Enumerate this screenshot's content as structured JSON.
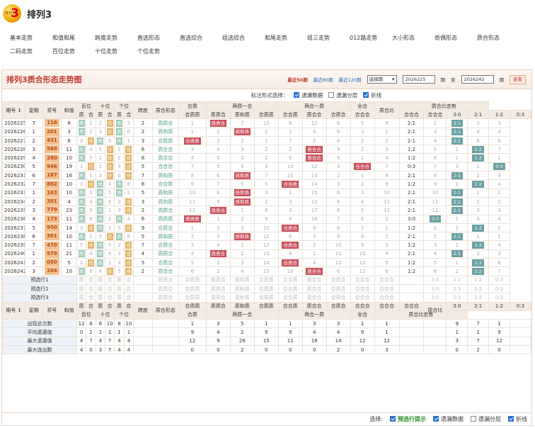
{
  "app": {
    "logo_num": "3",
    "logo_small": "排列",
    "title": "排列3"
  },
  "nav": {
    "row1": [
      "基本走势",
      "和值和尾",
      "跨度走势",
      "直选形态",
      "直选综合",
      "组选综合",
      "和尾走势",
      "组三走势",
      "012路走势",
      "大小形态",
      "奇偶形态",
      "质合形态"
    ],
    "row2": [
      "二码走势",
      "百位走势",
      "十位走势",
      "个位走势"
    ]
  },
  "panel": {
    "title": "排列3质合形态走势图",
    "range": [
      "最近50期",
      "最近80期",
      "最近120期"
    ],
    "select": "选择期",
    "from": "2026225",
    "to": "2026242",
    "qi": "期",
    "zhi": "至",
    "btn": "查看"
  },
  "options": {
    "label": "标注形式选择：",
    "o1": "遗漏数据",
    "o2": "遗漏分层",
    "o3": "折线"
  },
  "h": {
    "qihao": "期号",
    "xingqi": "星期",
    "kaijiang": "奖号",
    "hezhi": "和值",
    "bai": "百位",
    "shi": "十位",
    "ge": "个位",
    "kuadu": "跨度",
    "xingtai": "质合形态",
    "g1": "合质",
    "g2": "两质一合",
    "g3": "两合一质",
    "g4": "全合",
    "zhb": "质合比",
    "zhbzs": "质合比走势",
    "zhi": "质",
    "he": "合",
    "zhizhi": "合质质",
    "zhihezhi": "质质合",
    "zhiheh": "质和质",
    "hezhih": "合质质",
    "hehezhi": "合合质",
    "zhihehe": "质合合",
    "hezhihe": "合质合",
    "hehehe": "合合合",
    "hhh": "合合合",
    "r30": "3:0",
    "r21": "2:1",
    "r12": "1:2",
    "r03": "0:3"
  },
  "rows": [
    [
      "2026225",
      "7",
      "116",
      "8",
      "zhi",
      "he",
      "zhi",
      "2",
      0,
      1,
      7,
      15,
      8,
      12,
      6,
      5,
      "质质合",
      0,
      [
        "2:1",
        2,
        1,
        3
      ]
    ],
    [
      "2026226",
      "1",
      "201",
      "3",
      "zhi",
      "he",
      "zhi",
      "2",
      1,
      2,
      20,
      2,
      1,
      4,
      6,
      3,
      "质和质",
      0,
      [
        "2:1",
        3,
        0,
        4
      ]
    ],
    [
      "2026227",
      "2",
      "431",
      "8",
      "he",
      "zhi",
      "zhi",
      "3",
      2,
      3,
      2,
      1,
      0,
      5,
      4,
      2,
      "合质质",
      0,
      [
        "2:1",
        4,
        1,
        6
      ]
    ],
    [
      "2026228",
      "3",
      "560",
      "11",
      "zhi",
      "he",
      "he",
      "6",
      3,
      4,
      3,
      2,
      2,
      8,
      9,
      0,
      "质合合",
      0,
      [
        "1:2",
        5,
        1,
        0
      ]
    ],
    [
      "2026229",
      "4",
      "280",
      "10",
      "zhi",
      "he",
      "he",
      "8",
      4,
      5,
      3,
      2,
      6,
      6,
      9,
      1,
      "质合合",
      0,
      [
        "1:2",
        6,
        1,
        0
      ]
    ],
    [
      "2026230",
      "5",
      "946",
      "19",
      "he",
      "he",
      "he",
      "5",
      7,
      5,
      4,
      3,
      10,
      12,
      0,
      0,
      "合合合",
      0,
      [
        "0:3",
        7,
        3,
        1
      ]
    ],
    [
      "2026231",
      "6",
      "187",
      "16",
      "zhi",
      "he",
      "he",
      "7",
      8,
      6,
      6,
      7,
      11,
      13,
      2,
      1,
      "质和质",
      0,
      [
        "2:1",
        8,
        2,
        0
      ]
    ],
    [
      "2026232",
      "7",
      "802",
      "10",
      "he",
      "zhi",
      "zhi",
      "8",
      9,
      7,
      5,
      5,
      0,
      14,
      3,
      2,
      "合合质",
      0,
      [
        "1:2",
        9,
        1,
        0
      ]
    ],
    [
      "2026233",
      "1",
      "163",
      "10",
      "zhi",
      "zhi",
      "zhi",
      "5",
      10,
      8,
      6,
      3,
      1,
      15,
      6,
      3,
      "质和质",
      0,
      [
        "2:1",
        10,
        0,
        1
      ]
    ],
    [
      "2026234",
      "2",
      "301",
      "4",
      "zhi",
      "zhi",
      "he",
      "3",
      11,
      9,
      6,
      2,
      3,
      10,
      6,
      4,
      "质和质",
      0,
      [
        "2:1",
        11,
        1,
        2
      ]
    ],
    [
      "2026235",
      "3",
      "779",
      "23",
      "zhi",
      "zhi",
      "he",
      "2",
      12,
      0,
      1,
      8,
      3,
      17,
      6,
      5,
      "质质合",
      0,
      [
        "2:1",
        12,
        1,
        3
      ]
    ],
    [
      "2026236",
      "4",
      "173",
      "11",
      "zhi",
      "zhi",
      "zhi",
      "6",
      0,
      1,
      2,
      9,
      4,
      18,
      7,
      6,
      "质质质",
      0,
      [
        "3:0",
        0,
        1,
        4
      ]
    ],
    [
      "2026237",
      "5",
      "950",
      "14",
      "he",
      "zhi",
      "he",
      "9",
      1,
      2,
      3,
      10,
      5,
      0,
      8,
      7,
      "合质合",
      0,
      [
        "1:2",
        1,
        2,
        0
      ]
    ],
    [
      "2026238",
      "6",
      "361",
      "10",
      "zhi",
      "he",
      "zhi",
      "5",
      2,
      3,
      0,
      11,
      6,
      3,
      9,
      8,
      "质和质",
      0,
      [
        "2:1",
        2,
        1,
        1
      ]
    ],
    [
      "2026239",
      "7",
      "470",
      "11",
      "he",
      "zhi",
      "he",
      "7",
      3,
      4,
      1,
      12,
      7,
      0,
      10,
      9,
      "合质合",
      0,
      [
        "1:2",
        3,
        2,
        0
      ]
    ],
    [
      "2026240",
      "1",
      "579",
      "21",
      "zhi",
      "zhi",
      "he",
      "4",
      4,
      0,
      2,
      13,
      8,
      1,
      11,
      10,
      "质质合",
      0,
      [
        "2:1",
        4,
        1,
        3
      ]
    ],
    [
      "2026241",
      "2",
      "050",
      "5",
      "he",
      "zhi",
      "he",
      "5",
      5,
      1,
      3,
      14,
      9,
      0,
      12,
      11,
      "合质合",
      0,
      [
        "1:2",
        5,
        1,
        0
      ]
    ],
    [
      "2026242",
      "3",
      "244",
      "10",
      "zhi",
      "he",
      "he",
      "2",
      6,
      2,
      4,
      15,
      10,
      1,
      0,
      12,
      "质合合",
      0,
      [
        "1:2",
        6,
        2,
        0
      ]
    ]
  ],
  "pred": [
    "预选行1",
    "预选行2",
    "预选行3"
  ],
  "stats": {
    "labels": [
      "出现总次数",
      "平均遗漏值",
      "最大遗漏值",
      "最大连出数"
    ],
    "vals": [
      [
        "12",
        "6",
        "8",
        "10",
        "8",
        "10",
        "",
        "1",
        "3",
        "5",
        "1",
        "1",
        "3",
        "3",
        "1",
        "1",
        "9",
        "7",
        "1"
      ],
      [
        "0",
        "2",
        "1",
        "1",
        "1",
        "1",
        "",
        "9",
        "4",
        "2",
        "9",
        "9",
        "4",
        "4",
        "9",
        "1",
        "1",
        "1",
        "9"
      ],
      [
        "4",
        "7",
        "4",
        "7",
        "4",
        "4",
        "",
        "12",
        "9",
        "26",
        "15",
        "11",
        "18",
        "14",
        "12",
        "12",
        "3",
        "7",
        "12"
      ],
      [
        "4",
        "0",
        "3",
        "7",
        "4",
        "4",
        "",
        "0",
        "0",
        "2",
        "0",
        "0",
        "0",
        "2",
        "0",
        "3",
        "0",
        "2",
        "0"
      ]
    ]
  },
  "bottom": {
    "label": "选择:",
    "o1": "预选行提示",
    "o2": "遗漏数据",
    "o3": "遗漏分层",
    "o4": "折线"
  }
}
